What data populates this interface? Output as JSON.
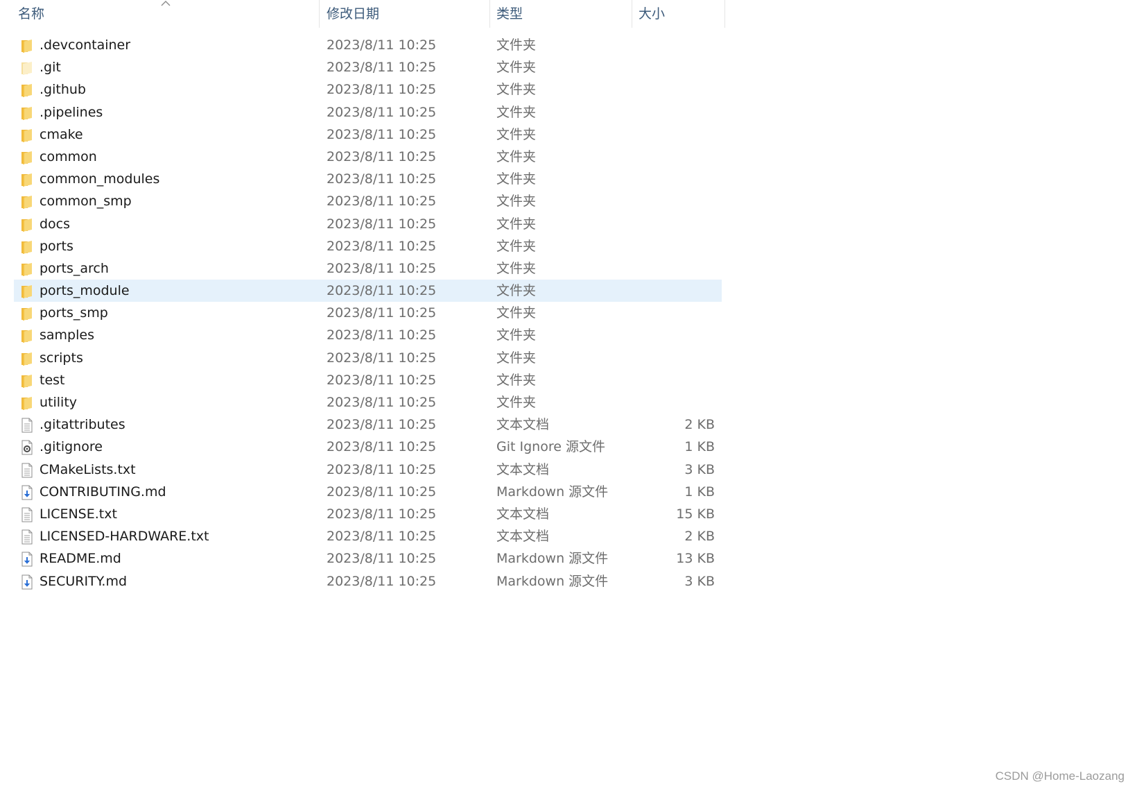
{
  "header": {
    "name": "名称",
    "date": "修改日期",
    "type": "类型",
    "size": "大小"
  },
  "colors": {
    "header_text": "#3c5a7a",
    "selected_row": "#e5f1fb",
    "folder": "#f4c244",
    "markdown_icon": "#2b6fd6"
  },
  "files": [
    {
      "name": ".devcontainer",
      "date": "2023/8/11 10:25",
      "type": "文件夹",
      "size": "",
      "icon": "folder-icon",
      "selected": false
    },
    {
      "name": ".git",
      "date": "2023/8/11 10:25",
      "type": "文件夹",
      "size": "",
      "icon": "hidden-folder-icon",
      "selected": false
    },
    {
      "name": ".github",
      "date": "2023/8/11 10:25",
      "type": "文件夹",
      "size": "",
      "icon": "folder-icon",
      "selected": false
    },
    {
      "name": ".pipelines",
      "date": "2023/8/11 10:25",
      "type": "文件夹",
      "size": "",
      "icon": "folder-icon",
      "selected": false
    },
    {
      "name": "cmake",
      "date": "2023/8/11 10:25",
      "type": "文件夹",
      "size": "",
      "icon": "folder-icon",
      "selected": false
    },
    {
      "name": "common",
      "date": "2023/8/11 10:25",
      "type": "文件夹",
      "size": "",
      "icon": "folder-icon",
      "selected": false
    },
    {
      "name": "common_modules",
      "date": "2023/8/11 10:25",
      "type": "文件夹",
      "size": "",
      "icon": "folder-icon",
      "selected": false
    },
    {
      "name": "common_smp",
      "date": "2023/8/11 10:25",
      "type": "文件夹",
      "size": "",
      "icon": "folder-icon",
      "selected": false
    },
    {
      "name": "docs",
      "date": "2023/8/11 10:25",
      "type": "文件夹",
      "size": "",
      "icon": "folder-icon",
      "selected": false
    },
    {
      "name": "ports",
      "date": "2023/8/11 10:25",
      "type": "文件夹",
      "size": "",
      "icon": "folder-icon",
      "selected": false
    },
    {
      "name": "ports_arch",
      "date": "2023/8/11 10:25",
      "type": "文件夹",
      "size": "",
      "icon": "folder-icon",
      "selected": false
    },
    {
      "name": "ports_module",
      "date": "2023/8/11 10:25",
      "type": "文件夹",
      "size": "",
      "icon": "folder-icon",
      "selected": true
    },
    {
      "name": "ports_smp",
      "date": "2023/8/11 10:25",
      "type": "文件夹",
      "size": "",
      "icon": "folder-icon",
      "selected": false
    },
    {
      "name": "samples",
      "date": "2023/8/11 10:25",
      "type": "文件夹",
      "size": "",
      "icon": "folder-icon",
      "selected": false
    },
    {
      "name": "scripts",
      "date": "2023/8/11 10:25",
      "type": "文件夹",
      "size": "",
      "icon": "folder-icon",
      "selected": false
    },
    {
      "name": "test",
      "date": "2023/8/11 10:25",
      "type": "文件夹",
      "size": "",
      "icon": "folder-icon",
      "selected": false
    },
    {
      "name": "utility",
      "date": "2023/8/11 10:25",
      "type": "文件夹",
      "size": "",
      "icon": "folder-icon",
      "selected": false
    },
    {
      "name": ".gitattributes",
      "date": "2023/8/11 10:25",
      "type": "文本文档",
      "size": "2 KB",
      "icon": "text-file-icon",
      "selected": false
    },
    {
      "name": ".gitignore",
      "date": "2023/8/11 10:25",
      "type": "Git Ignore 源文件",
      "size": "1 KB",
      "icon": "settings-file-icon",
      "selected": false
    },
    {
      "name": "CMakeLists.txt",
      "date": "2023/8/11 10:25",
      "type": "文本文档",
      "size": "3 KB",
      "icon": "text-file-icon",
      "selected": false
    },
    {
      "name": "CONTRIBUTING.md",
      "date": "2023/8/11 10:25",
      "type": "Markdown 源文件",
      "size": "1 KB",
      "icon": "markdown-file-icon",
      "selected": false
    },
    {
      "name": "LICENSE.txt",
      "date": "2023/8/11 10:25",
      "type": "文本文档",
      "size": "15 KB",
      "icon": "text-file-icon",
      "selected": false
    },
    {
      "name": "LICENSED-HARDWARE.txt",
      "date": "2023/8/11 10:25",
      "type": "文本文档",
      "size": "2 KB",
      "icon": "text-file-icon",
      "selected": false
    },
    {
      "name": "README.md",
      "date": "2023/8/11 10:25",
      "type": "Markdown 源文件",
      "size": "13 KB",
      "icon": "markdown-file-icon",
      "selected": false
    },
    {
      "name": "SECURITY.md",
      "date": "2023/8/11 10:25",
      "type": "Markdown 源文件",
      "size": "3 KB",
      "icon": "markdown-file-icon",
      "selected": false
    }
  ],
  "watermark": "CSDN @Home-Laozang"
}
